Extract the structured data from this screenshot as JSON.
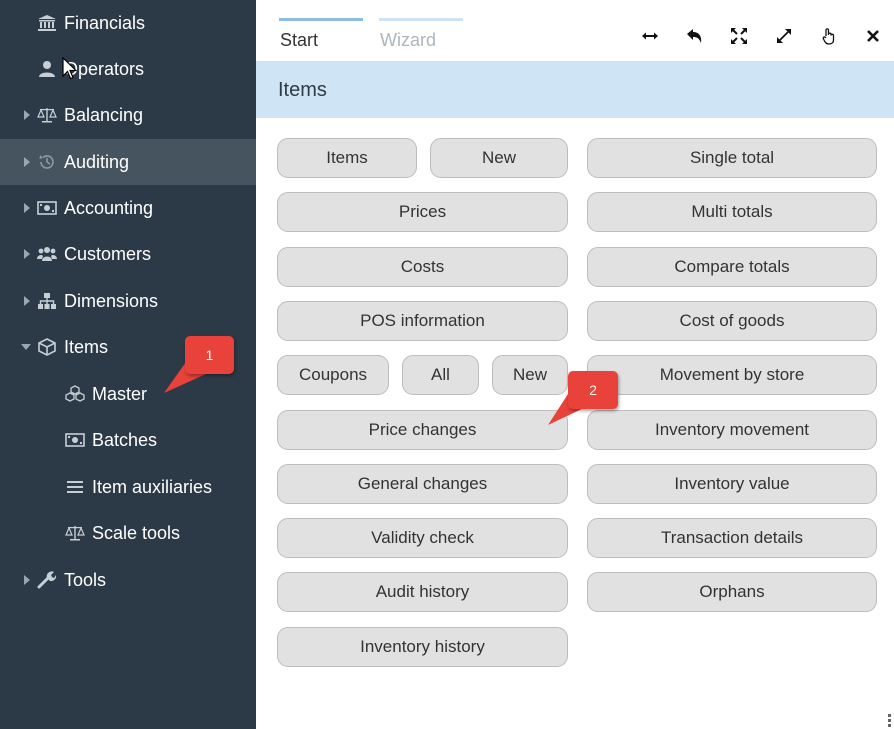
{
  "sidebar": {
    "items": [
      {
        "label": "Financials",
        "icon": "bank-icon"
      },
      {
        "label": "Operators",
        "icon": "user-icon"
      },
      {
        "label": "Balancing",
        "icon": "scale-icon"
      },
      {
        "label": "Auditing",
        "icon": "history-icon"
      },
      {
        "label": "Accounting",
        "icon": "money-icon"
      },
      {
        "label": "Customers",
        "icon": "users-icon"
      },
      {
        "label": "Dimensions",
        "icon": "sitemap-icon"
      },
      {
        "label": "Items",
        "icon": "cube-icon"
      },
      {
        "label": "Master",
        "icon": "cubes-icon"
      },
      {
        "label": "Batches",
        "icon": "money-icon"
      },
      {
        "label": "Item auxiliaries",
        "icon": "menu-icon"
      },
      {
        "label": "Scale tools",
        "icon": "scale-icon"
      },
      {
        "label": "Tools",
        "icon": "wrench-icon"
      }
    ],
    "active": "Auditing",
    "expanded": "Items"
  },
  "callouts": {
    "first": "1",
    "second": "2",
    "color": "#e8423a"
  },
  "tabs": {
    "start": "Start",
    "wizard": "Wizard"
  },
  "toolbar": [
    "resize-horizontal-icon",
    "undo-icon",
    "fullscreen-icon",
    "expand-icon",
    "hand-pointer-icon",
    "close-icon"
  ],
  "section": {
    "title": "Items"
  },
  "buttons": {
    "items": "Items",
    "new_item": "New",
    "prices": "Prices",
    "costs": "Costs",
    "pos_information": "POS information",
    "coupons": "Coupons",
    "all": "All",
    "new_coupon": "New",
    "price_changes": "Price changes",
    "general_changes": "General changes",
    "validity_check": "Validity check",
    "audit_history": "Audit history",
    "inventory_history": "Inventory history",
    "single_total": "Single total",
    "multi_totals": "Multi totals",
    "compare_totals": "Compare totals",
    "cost_of_goods": "Cost of goods",
    "movement_by_store": "Movement by store",
    "inventory_movement": "Inventory movement",
    "inventory_value": "Inventory value",
    "transaction_details": "Transaction details",
    "orphans": "Orphans"
  },
  "colors": {
    "sidebar": "#2c3a47",
    "sidebar_active": "#46545f",
    "header": "#cfe4f4",
    "tab_accent": "#8fbde2",
    "button": "#e1e1e1"
  }
}
